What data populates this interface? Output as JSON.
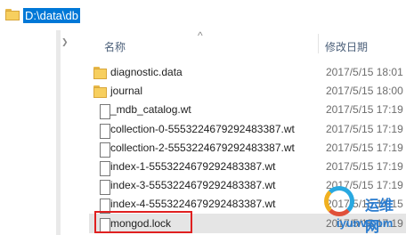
{
  "address_bar": {
    "path": "D:\\data\\db"
  },
  "columns": {
    "name": "名称",
    "date_modified": "修改日期",
    "sort_indicator": "^"
  },
  "nav": {
    "collapse_arrow": "❯"
  },
  "files": [
    {
      "name": "diagnostic.data",
      "type": "folder",
      "date": "2017/5/15 18:01"
    },
    {
      "name": "journal",
      "type": "folder",
      "date": "2017/5/15 18:00"
    },
    {
      "name": "_mdb_catalog.wt",
      "type": "file",
      "date": "2017/5/15 17:19"
    },
    {
      "name": "collection-0-5553224679292483387.wt",
      "type": "file",
      "date": "2017/5/15 17:19"
    },
    {
      "name": "collection-2-5553224679292483387.wt",
      "type": "file",
      "date": "2017/5/15 17:19"
    },
    {
      "name": "index-1-5553224679292483387.wt",
      "type": "file",
      "date": "2017/5/15 17:19"
    },
    {
      "name": "index-3-5553224679292483387.wt",
      "type": "file",
      "date": "2017/5/15 17:19"
    },
    {
      "name": "index-4-5553224679292483387.wt",
      "type": "file",
      "date": "2017/5/15 17:15"
    },
    {
      "name": "mongod.lock",
      "type": "file",
      "date": "2017/5/15 17:19"
    }
  ],
  "highlighted_file": "mongod.lock",
  "colors": {
    "selection": "#0078d7",
    "highlight_box": "#e02020",
    "folder": "#f7cf5f"
  },
  "watermark": {
    "text_cn": "运维网",
    "url": "iyunv.com"
  }
}
